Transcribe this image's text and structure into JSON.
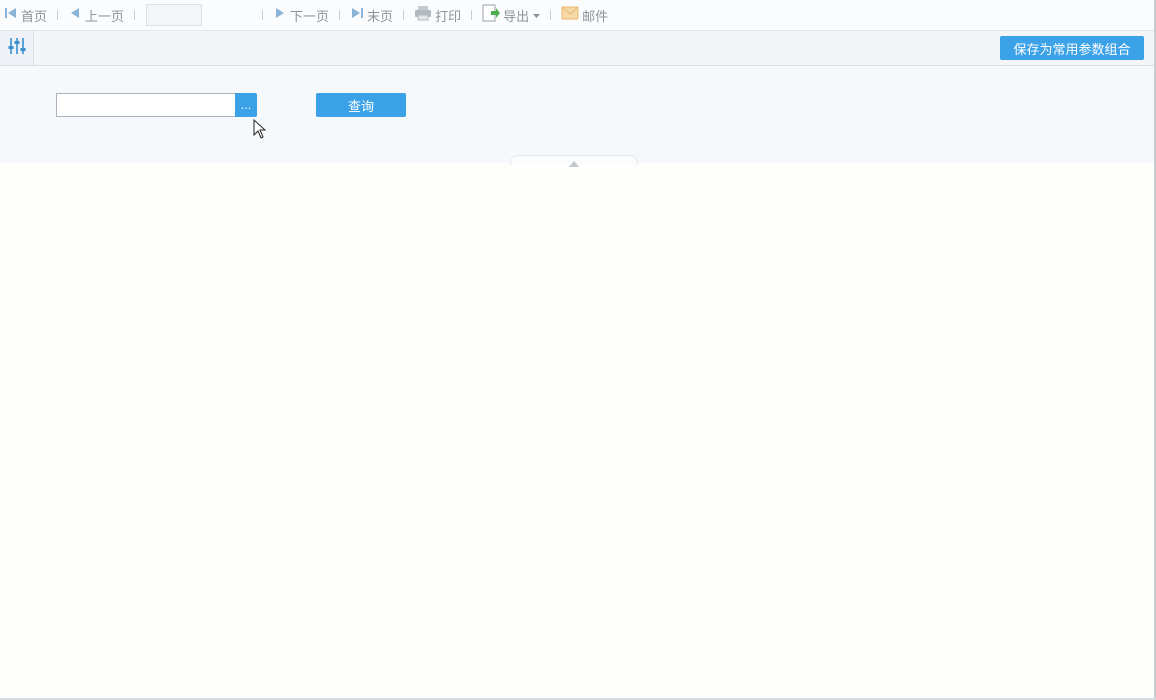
{
  "toolbar": {
    "first_label": "首页",
    "prev_label": "上一页",
    "page_value": "",
    "next_label": "下一页",
    "last_label": "末页",
    "print_label": "打印",
    "export_label": "导出",
    "mail_label": "邮件"
  },
  "params": {
    "save_label": "保存为常用参数组合"
  },
  "query": {
    "input_value": "",
    "ellipsis_label": "...",
    "query_label": "查询"
  },
  "colors": {
    "accent": "#3ba2e8",
    "toolbar_text": "#8d939a",
    "panel_bg": "#f6f9fc"
  },
  "icons": [
    "first-page-icon",
    "prev-page-icon",
    "next-page-icon",
    "last-page-icon",
    "print-icon",
    "export-icon",
    "mail-icon",
    "sliders-icon",
    "mouse-cursor-icon"
  ]
}
